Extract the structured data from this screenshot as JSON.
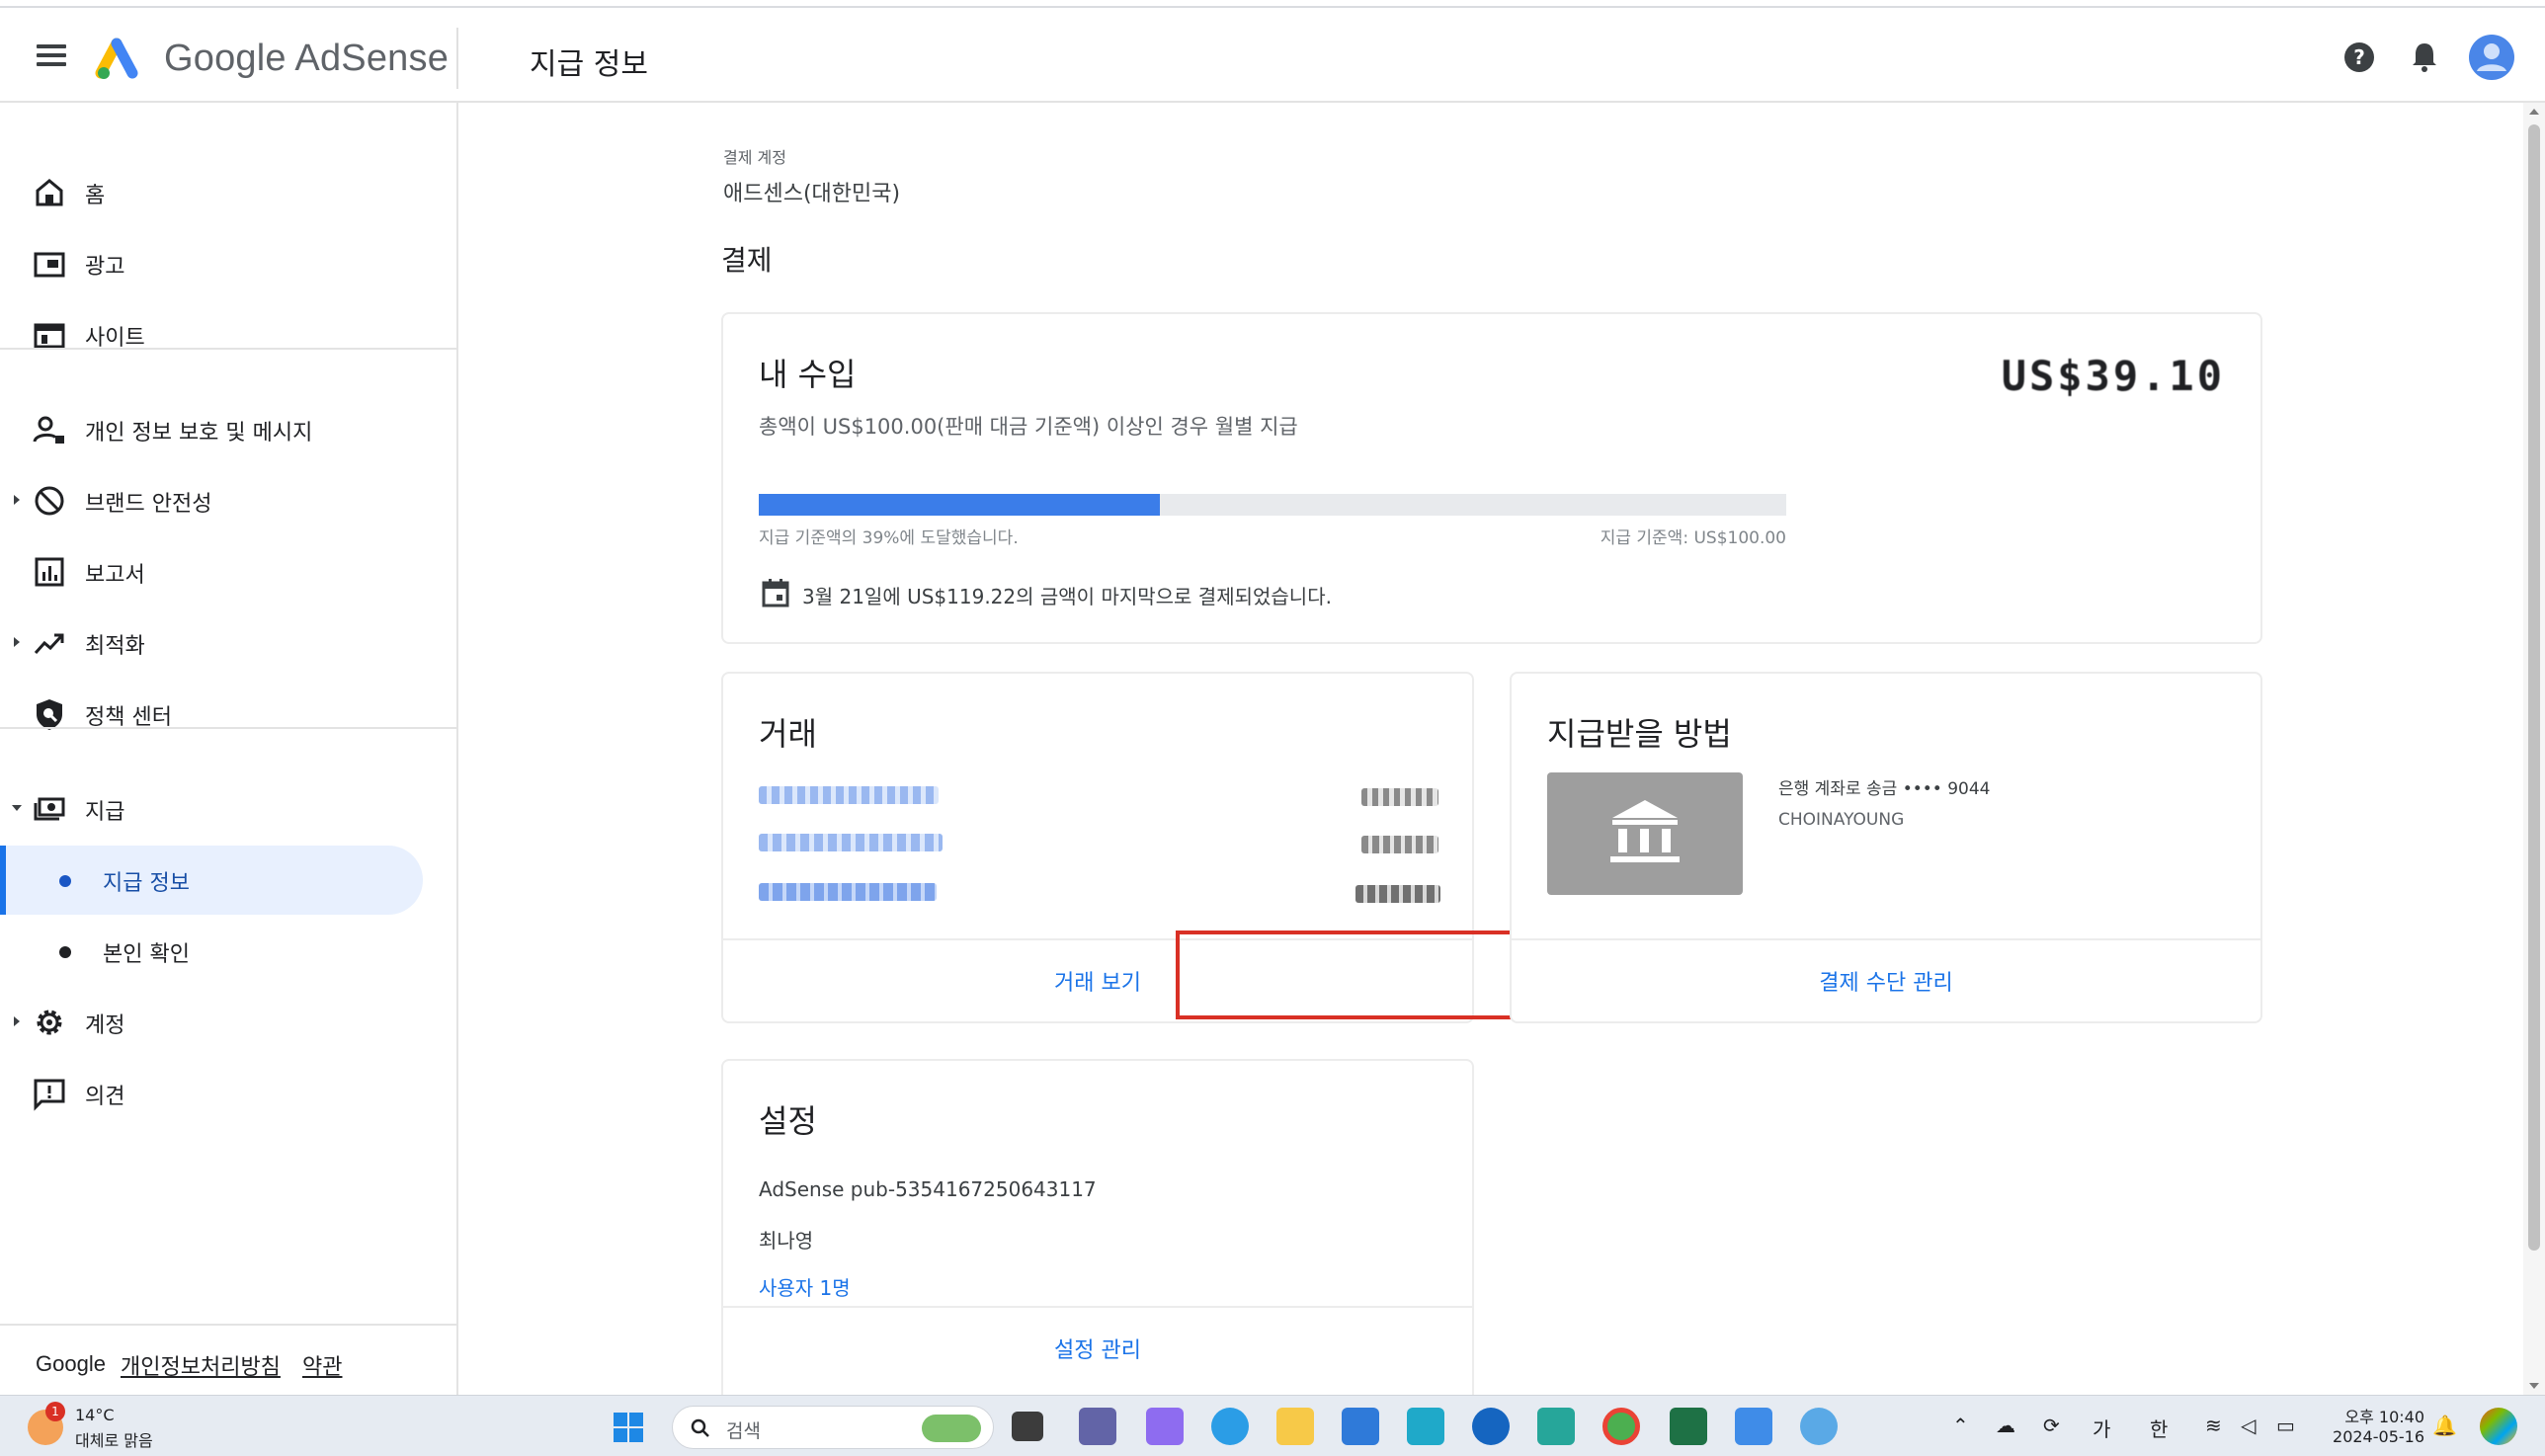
{
  "header": {
    "brand_name": "Google AdSense",
    "page_title": "지급 정보"
  },
  "sidebar": {
    "items": [
      {
        "label": "홈"
      },
      {
        "label": "광고"
      },
      {
        "label": "사이트"
      },
      {
        "label": "개인 정보 보호 및 메시지"
      },
      {
        "label": "브랜드 안전성"
      },
      {
        "label": "보고서"
      },
      {
        "label": "최적화"
      },
      {
        "label": "정책 센터"
      },
      {
        "label": "지급"
      },
      {
        "label": "계정"
      },
      {
        "label": "의견"
      }
    ],
    "sub_items": [
      {
        "label": "지급 정보"
      },
      {
        "label": "본인 확인"
      }
    ],
    "footer": {
      "brand": "Google",
      "privacy_link": "개인정보처리방침",
      "terms_link": "약관"
    }
  },
  "main": {
    "account_label": "결제 계정",
    "account_value": "애드센스(대한민국)",
    "section_title": "결제",
    "earnings": {
      "title": "내 수입",
      "amount": "US$39.10",
      "subtitle": "총액이 US$100.00(판매 대금 기준액) 이상인 경우 월별 지급",
      "progress_fraction": 0.39,
      "progress_left_text": "지급 기준액의 39%에 도달했습니다.",
      "progress_right_text": "지급 기준액: US$100.00",
      "last_payment": "3월 21일에 US$119.22의 금액이 마지막으로 결제되었습니다."
    },
    "transactions": {
      "title": "거래",
      "action_label": "거래 보기"
    },
    "payment_method": {
      "title": "지급받을 방법",
      "line1": "은행 계좌로 송금 •••• 9044",
      "line2": "CHOINAYOUNG",
      "action_label": "결제 수단 관리"
    },
    "settings": {
      "title": "설정",
      "publisher_id": "AdSense pub-5354167250643117",
      "name": "최나영",
      "users_link": "사용자 1명",
      "action_label": "설정 관리"
    }
  },
  "taskbar": {
    "weather_badge": "1",
    "weather_temp": "14°C",
    "weather_desc": "대체로 맑음",
    "search_placeholder": "검색",
    "ime_lang": "가",
    "ime_mode": "한",
    "clock_time": "오후 10:40",
    "clock_date": "2024-05-16"
  },
  "colors": {
    "accent": "#1a73e8",
    "highlight_border": "#d93025",
    "progress_fill": "#3b7de9",
    "active_nav_bg": "#e8f0fe"
  }
}
